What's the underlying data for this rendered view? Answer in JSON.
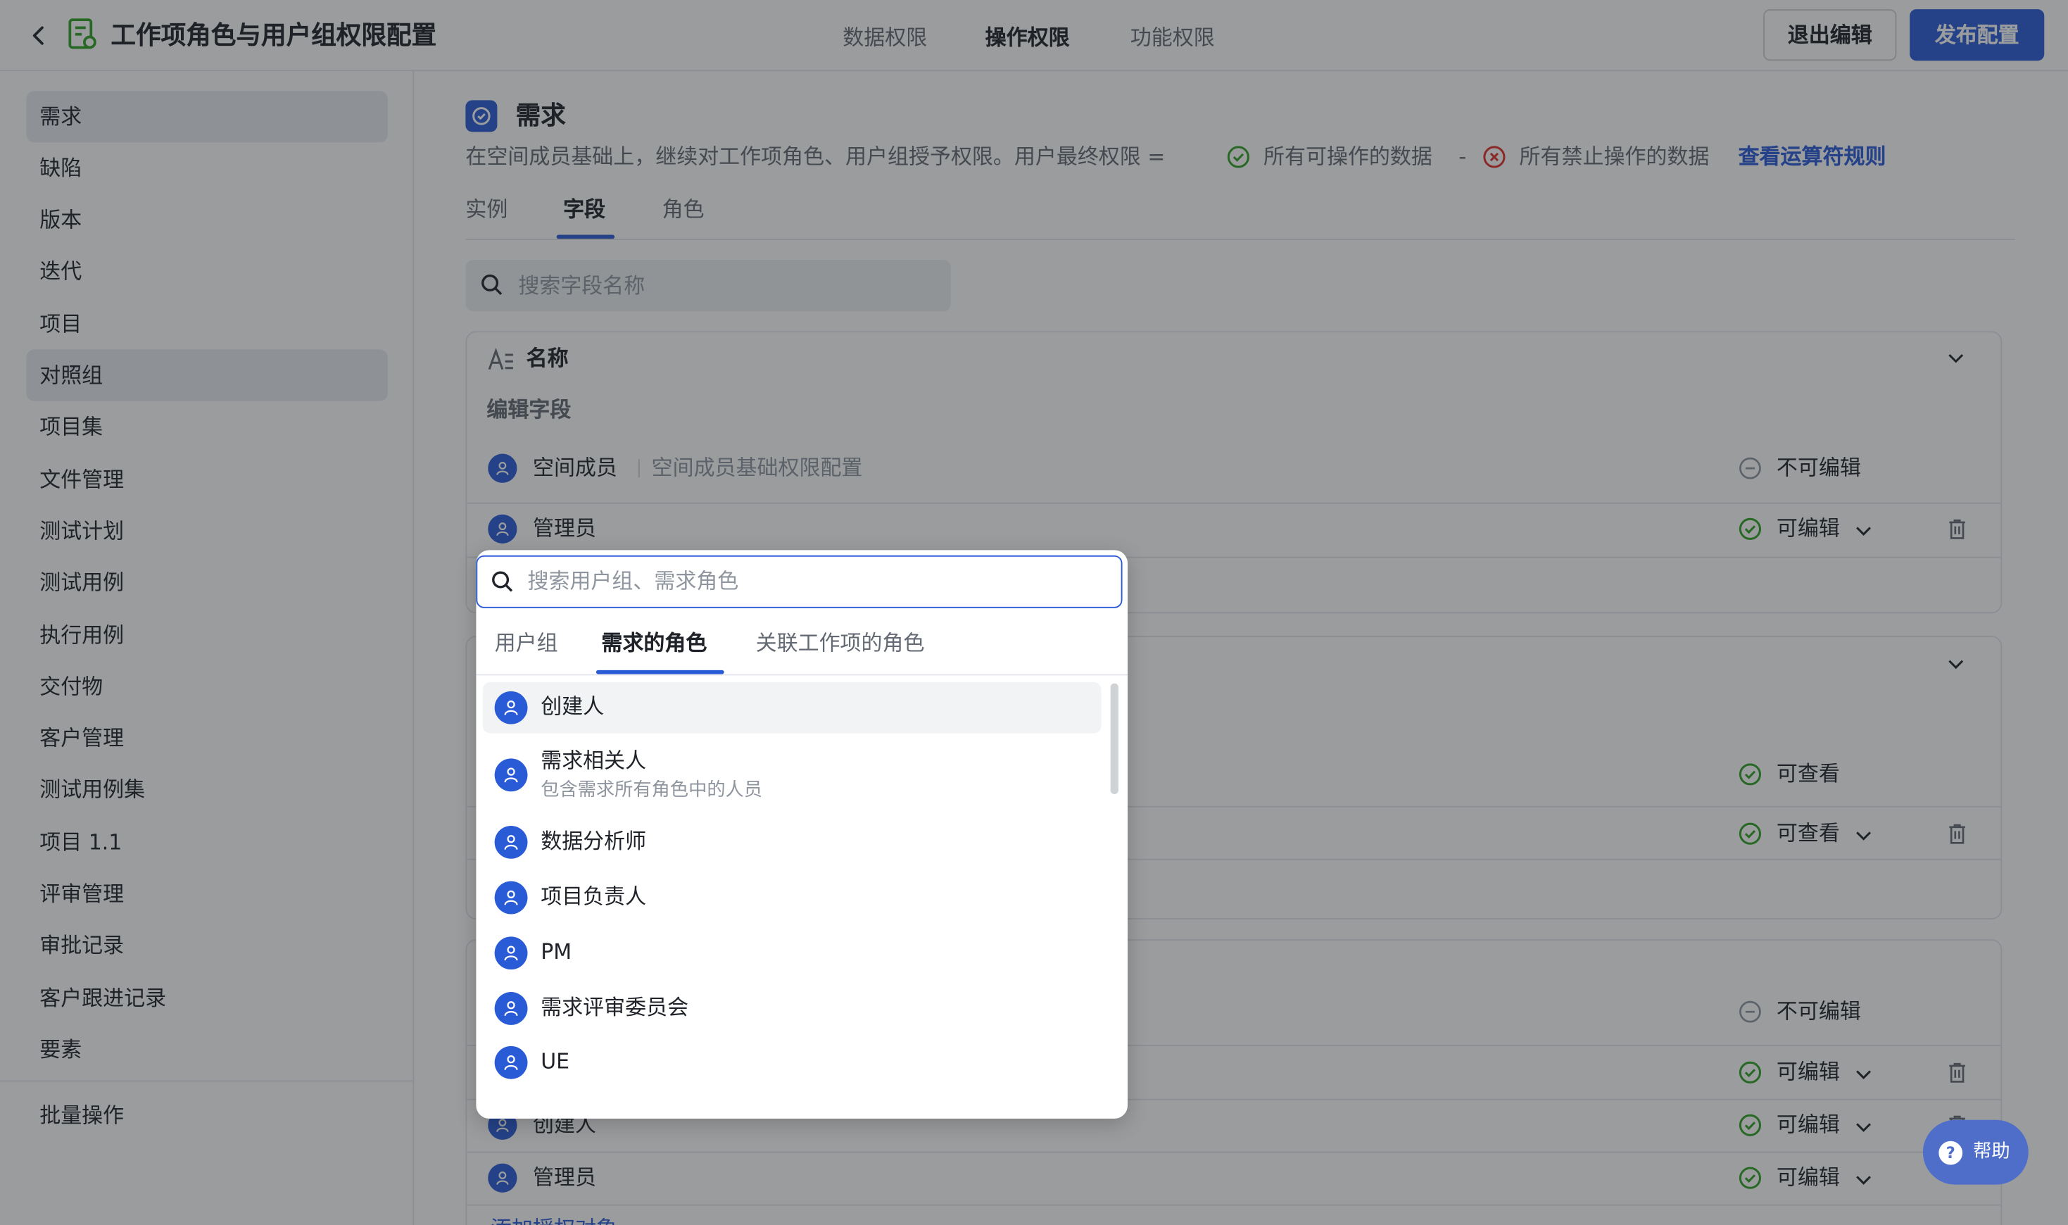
{
  "header": {
    "title": "工作项角色与用户组权限配置",
    "tabs": [
      {
        "label": "数据权限"
      },
      {
        "label": "操作权限"
      },
      {
        "label": "功能权限"
      }
    ],
    "active_tab": "操作权限",
    "exit_label": "退出编辑",
    "publish_label": "发布配置"
  },
  "sidebar": {
    "items": [
      {
        "label": "需求"
      },
      {
        "label": "缺陷"
      },
      {
        "label": "版本"
      },
      {
        "label": "迭代"
      },
      {
        "label": "项目"
      },
      {
        "label": "对照组"
      },
      {
        "label": "项目集"
      },
      {
        "label": "文件管理"
      },
      {
        "label": "测试计划"
      },
      {
        "label": "测试用例"
      },
      {
        "label": "执行用例"
      },
      {
        "label": "交付物"
      },
      {
        "label": "客户管理"
      },
      {
        "label": "测试用例集"
      },
      {
        "label": "项目 1.1"
      },
      {
        "label": "评审管理"
      },
      {
        "label": "审批记录"
      },
      {
        "label": "客户跟进记录"
      },
      {
        "label": "要素"
      }
    ],
    "batch_label": "批量操作"
  },
  "main": {
    "section_title": "需求",
    "desc_prefix": "在空间成员基础上，继续对工作项角色、用户组授予权限。用户最终权限 =",
    "desc_allowed": "所有可操作的数据",
    "desc_minus": "-",
    "desc_denied": "所有禁止操作的数据",
    "desc_link": "查看运算符规则",
    "subtabs": [
      {
        "label": "实例"
      },
      {
        "label": "字段"
      },
      {
        "label": "角色"
      }
    ],
    "field_search_placeholder": "搜索字段名称",
    "card1": {
      "field_name": "名称",
      "edit_field_label": "编辑字段",
      "space_member": "空间成员",
      "space_member_desc": "空间成员基础权限配置",
      "not_editable": "不可编辑",
      "admin": "管理员",
      "editable": "可编辑"
    },
    "card2": {
      "viewable": "可查看"
    },
    "card3": {
      "not_editable": "不可编辑",
      "editable": "可编辑",
      "creator": "创建人",
      "admin": "管理员",
      "add_partial": "添加授权对象"
    }
  },
  "dropdown": {
    "search_placeholder": "搜索用户组、需求角色",
    "tabs": [
      {
        "label": "用户组"
      },
      {
        "label": "需求的角色"
      },
      {
        "label": "关联工作项的角色"
      }
    ],
    "items": [
      {
        "label": "创建人"
      },
      {
        "label": "需求相关人",
        "desc": "包含需求所有角色中的人员"
      },
      {
        "label": "数据分析师"
      },
      {
        "label": "项目负责人"
      },
      {
        "label": "PM"
      },
      {
        "label": "需求评审委员会"
      },
      {
        "label": "UE"
      }
    ]
  },
  "help": {
    "label": "帮助"
  },
  "colors": {
    "accent": "#2a5bd7",
    "success": "#2ea121",
    "danger": "#e22e28",
    "overlay": "rgba(31,35,41,0.45)"
  }
}
